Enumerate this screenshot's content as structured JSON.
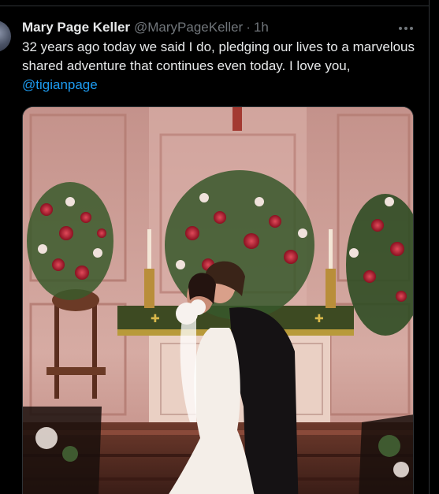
{
  "tweet": {
    "author_name": "Mary Page Keller",
    "author_handle": "@MaryPageKeller",
    "separator": "·",
    "timestamp": "1h",
    "text_before_mention": "32 years ago today we said I do, pledging our lives to a marvelous shared adventure that continues even today. I love you, ",
    "mention": "@tigianpage"
  },
  "icons": {
    "more": "more-horizontal-icon"
  },
  "colors": {
    "background": "#000000",
    "primary_text": "#e7e9ea",
    "secondary_text": "#71767b",
    "link": "#1d9bf0",
    "border": "#2f3336"
  }
}
